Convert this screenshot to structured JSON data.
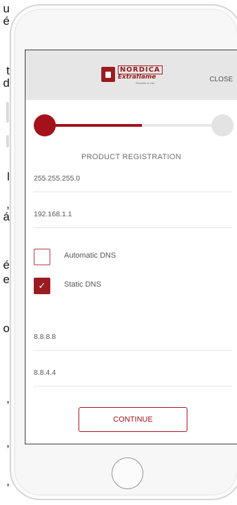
{
  "background_glyphs": [
    "u",
    "é",
    "t",
    "d",
    ",",
    "l",
    ",",
    "á",
    "é",
    "e",
    "o",
    ",",
    ",",
    ","
  ],
  "header": {
    "logo_top": "NORDICA",
    "logo_bottom": "Extraflame",
    "logo_tagline": "Riscalda la vita.",
    "close_label": "CLOSE"
  },
  "progress": {
    "fraction": 0.55,
    "active_color": "#a3121a"
  },
  "section_title": "PRODUCT REGISTRATION",
  "fields": {
    "subnet_mask": "255.255.255.0",
    "gateway": "192.168.1.1",
    "dns_primary": "8.8.8.8",
    "dns_secondary": "8.8.4.4"
  },
  "options": {
    "automatic_dns": {
      "label": "Automatic DNS",
      "checked": false
    },
    "static_dns": {
      "label": "Static DNS",
      "checked": true,
      "check_mark": "✓"
    }
  },
  "continue_label": "CONTINUE",
  "colors": {
    "brand": "#9b1c20",
    "header_bg": "#e6e6e6"
  }
}
